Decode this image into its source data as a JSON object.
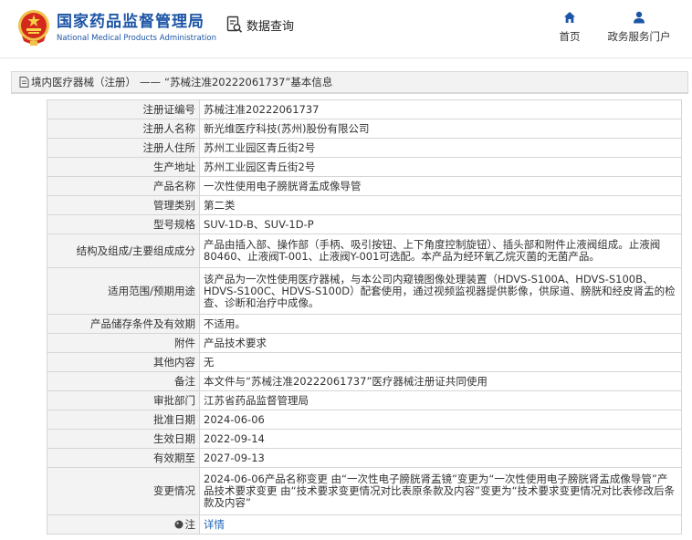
{
  "header": {
    "site_name_cn": "国家药品监督管理局",
    "site_name_en": "National Medical Products Administration",
    "query_label": "数据查询",
    "nav": {
      "home": "首页",
      "portal": "政务服务门户"
    }
  },
  "breadcrumb": {
    "category": "境内医疗器械（注册）",
    "separator": "——",
    "title": "“苏械注准20222061737”基本信息"
  },
  "rows": [
    {
      "label": "注册证编号",
      "value": "苏械注准20222061737"
    },
    {
      "label": "注册人名称",
      "value": "新光维医疗科技(苏州)股份有限公司"
    },
    {
      "label": "注册人住所",
      "value": "苏州工业园区青丘街2号"
    },
    {
      "label": "生产地址",
      "value": "苏州工业园区青丘街2号"
    },
    {
      "label": "产品名称",
      "value": "一次性使用电子膀胱肾盂成像导管"
    },
    {
      "label": "管理类别",
      "value": "第二类"
    },
    {
      "label": "型号规格",
      "value": "SUV-1D-B、SUV-1D-P"
    },
    {
      "label": "结构及组成/主要组成成分",
      "value": "产品由插入部、操作部（手柄、吸引按钮、上下角度控制旋钮）、插头部和附件止液阀组成。止液阀80460、止液阀T-001、止液阀Y-001可选配。本产品为经环氧乙烷灭菌的无菌产品。"
    },
    {
      "label": "适用范围/预期用途",
      "value": "该产品为一次性使用医疗器械，与本公司内窥镜图像处理装置（HDVS-S100A、HDVS-S100B、HDVS-S100C、HDVS-S100D）配套使用，通过视频监视器提供影像，供尿道、膀胱和经皮肾盂的检查、诊断和治疗中成像。"
    },
    {
      "label": "产品储存条件及有效期",
      "value": "不适用。"
    },
    {
      "label": "附件",
      "value": "产品技术要求"
    },
    {
      "label": "其他内容",
      "value": "无"
    },
    {
      "label": "备注",
      "value": "本文件与“苏械注准20222061737”医疗器械注册证共同使用"
    },
    {
      "label": "审批部门",
      "value": "江苏省药品监督管理局"
    },
    {
      "label": "批准日期",
      "value": "2024-06-06"
    },
    {
      "label": "生效日期",
      "value": "2022-09-14"
    },
    {
      "label": "有效期至",
      "value": "2027-09-13"
    },
    {
      "label": "变更情况",
      "value": "2024-06-06产品名称变更 由“一次性电子膀胱肾盂镜”变更为“一次性使用电子膀胱肾盂成像导管”产品技术要求变更 由“技术要求变更情况对比表原条款及内容”变更为“技术要求变更情况对比表修改后条款及内容”"
    },
    {
      "label": "注",
      "value": "详情"
    }
  ],
  "colors": {
    "brand_blue": "#1d55a6",
    "emblem_red": "#d42a1e",
    "link_blue": "#1d63b5"
  },
  "icons": [
    "national-emblem-icon",
    "data-query-icon",
    "home-icon",
    "user-icon",
    "document-icon",
    "note-icon"
  ]
}
